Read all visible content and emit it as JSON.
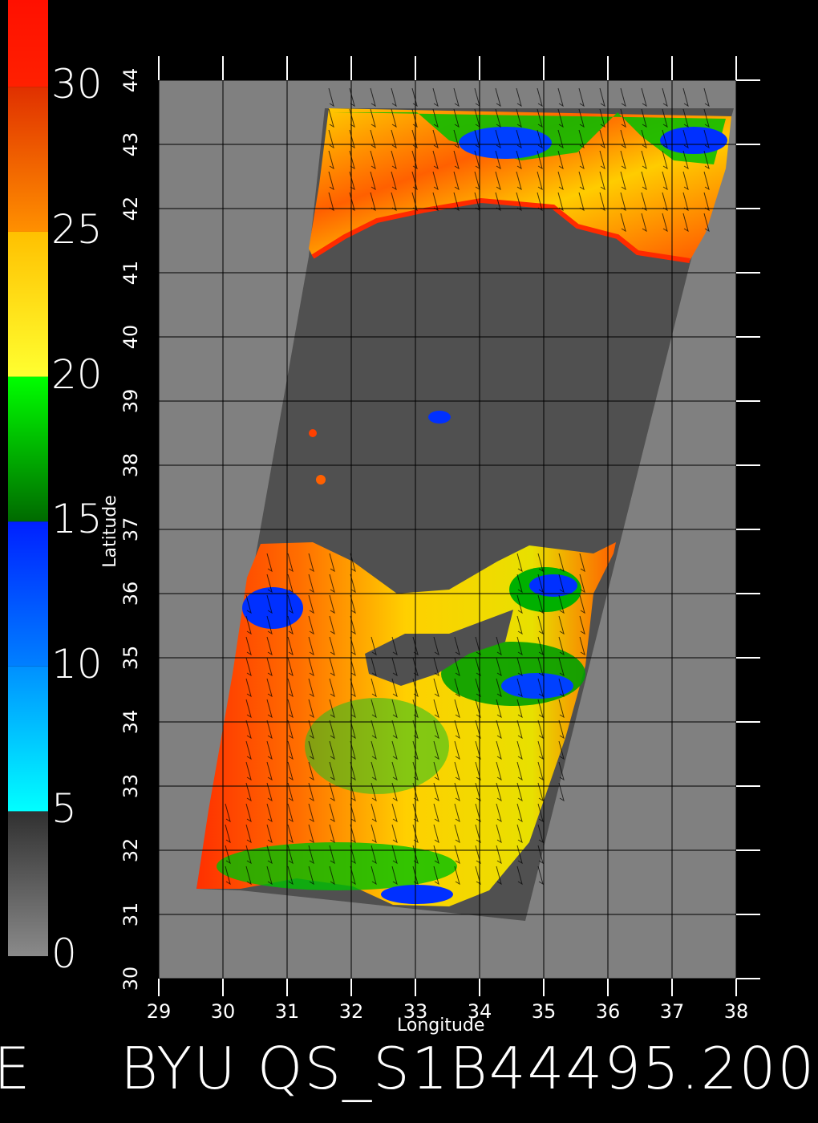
{
  "colorbar": {
    "labels": [
      "30",
      "25",
      "20",
      "15",
      "10",
      "5",
      "0"
    ],
    "stops": [
      {
        "value": 0,
        "color": "#8a8a8a"
      },
      {
        "value": 5,
        "color": "#333333"
      },
      {
        "value": 5,
        "color": "#00ffff"
      },
      {
        "value": 10,
        "color": "#0080ff"
      },
      {
        "value": 15,
        "color": "#0020ff"
      },
      {
        "value": 15,
        "color": "#007000"
      },
      {
        "value": 20,
        "color": "#00ff00"
      },
      {
        "value": 20,
        "color": "#ffff30"
      },
      {
        "value": 25,
        "color": "#ffc000"
      },
      {
        "value": 30,
        "color": "#e03000"
      },
      {
        "value": 33,
        "color": "#ff1000"
      }
    ]
  },
  "axes": {
    "xlabel": "Longitude",
    "ylabel": "Latitude",
    "lon_ticks": [
      "29",
      "30",
      "31",
      "32",
      "33",
      "34",
      "35",
      "36",
      "37",
      "38"
    ],
    "lat_ticks": [
      "30",
      "31",
      "32",
      "33",
      "34",
      "35",
      "36",
      "37",
      "38",
      "39",
      "40",
      "41",
      "42",
      "43",
      "44"
    ],
    "lon_range": [
      29,
      38
    ],
    "lat_range": [
      30,
      44
    ],
    "grid": true
  },
  "footer": {
    "left_fragment": "E",
    "text": "BYU QS_S1B44495.200"
  },
  "colors": {
    "background": "#000000",
    "land": "#808080",
    "no_data": "#555555"
  }
}
